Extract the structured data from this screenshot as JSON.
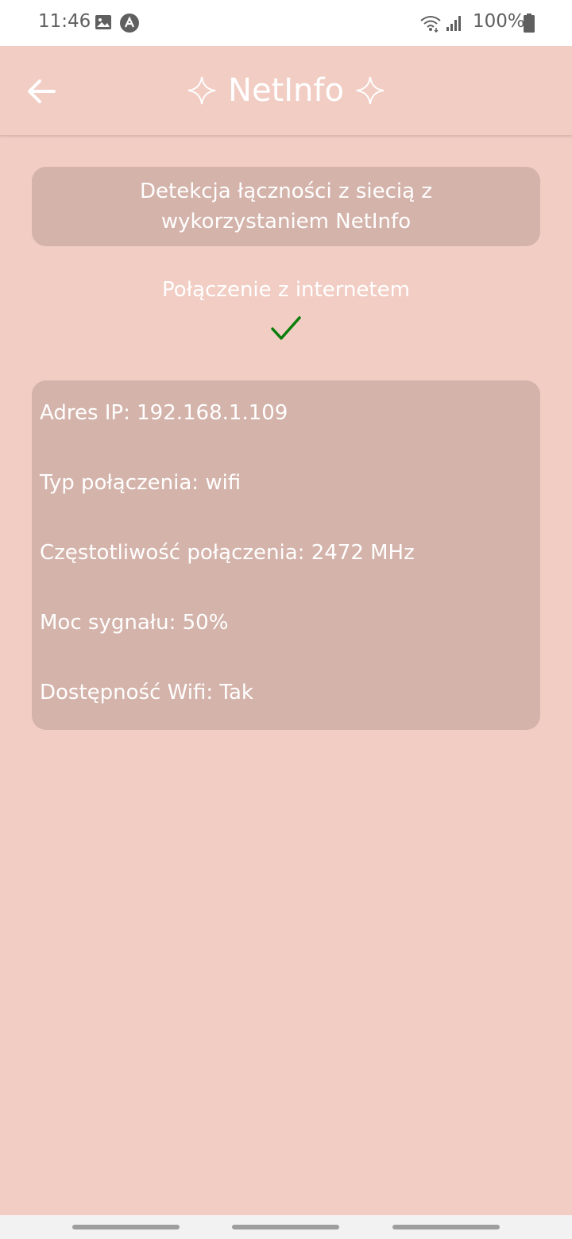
{
  "status_bar": {
    "time": "11:46",
    "battery": "100%",
    "icons": [
      "gallery-icon",
      "app-notification-icon",
      "wifi-icon",
      "signal-icon",
      "battery-icon"
    ]
  },
  "header": {
    "title": "NetInfo",
    "icons": [
      "back-arrow-icon",
      "sparkle-icon"
    ]
  },
  "description": "Detekcja łączności z siecią z wykorzystaniem NetInfo",
  "connection": {
    "label": "Połączenie z internetem",
    "status_icon": "checkmark-icon",
    "status_color": "#0a7d0a"
  },
  "info": {
    "ip": "Adres IP: 192.168.1.109",
    "type": "Typ połączenia: wifi",
    "frequency": "Częstotliwość połączenia: 2472 MHz",
    "strength": "Moc sygnału: 50%",
    "wifi_available": "Dostępność Wifi: Tak"
  },
  "colors": {
    "background": "#f1cdc4",
    "card": "#d4b3aa",
    "text": "#ffffff"
  }
}
